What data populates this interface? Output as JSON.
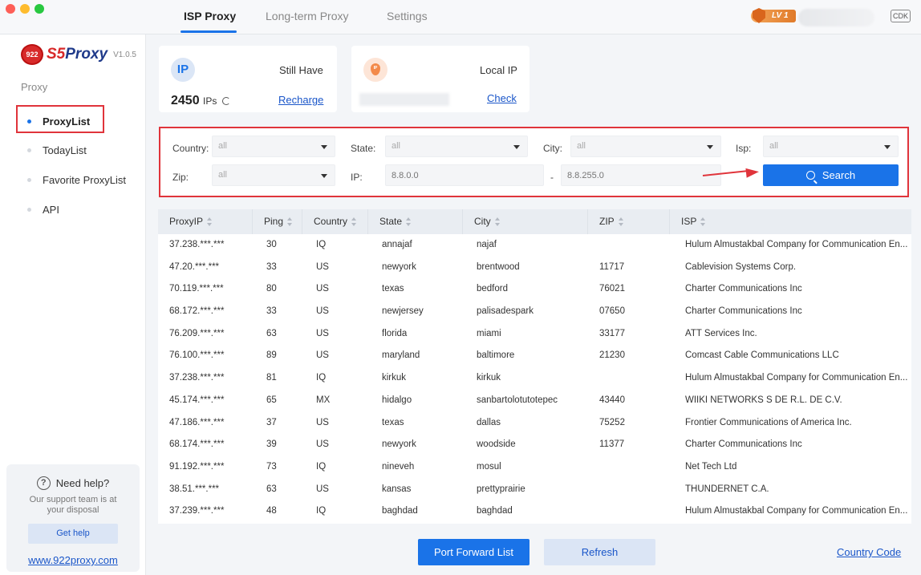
{
  "titlebar": {
    "tabs": [
      {
        "label": "ISP Proxy",
        "active": true
      },
      {
        "label": "Long-term Proxy",
        "active": false
      },
      {
        "label": "Settings",
        "active": false
      }
    ],
    "level_badge": "LV 1",
    "cdk_label": "CDK"
  },
  "sidebar": {
    "logo_num": "922",
    "logo_s5": "S5",
    "logo_proxy": "Proxy",
    "version": "V1.0.5",
    "section": "Proxy",
    "items": [
      {
        "label": "ProxyList",
        "active": true
      },
      {
        "label": "TodayList",
        "active": false
      },
      {
        "label": "Favorite ProxyList",
        "active": false
      },
      {
        "label": "API",
        "active": false
      }
    ],
    "help": {
      "title": "Need help?",
      "subtitle": "Our support team is at your disposal",
      "button": "Get help",
      "link": "www.922proxy.com"
    }
  },
  "ip_card": {
    "icon_text": "IP",
    "label": "Still Have",
    "count": "2450",
    "unit": "IPs",
    "link": "Recharge"
  },
  "local_card": {
    "icon_text": "IP",
    "label": "Local IP",
    "link": "Check"
  },
  "filters": {
    "country_label": "Country:",
    "country_value": "all",
    "state_label": "State:",
    "state_value": "all",
    "city_label": "City:",
    "city_value": "all",
    "isp_label": "Isp:",
    "isp_value": "all",
    "zip_label": "Zip:",
    "zip_value": "all",
    "ip_label": "IP:",
    "ip_from_placeholder": "8.8.0.0",
    "ip_dash": "-",
    "ip_to_placeholder": "8.8.255.0",
    "search_label": "Search"
  },
  "table": {
    "headers": [
      "ProxyIP",
      "Ping",
      "Country",
      "State",
      "City",
      "ZIP",
      "ISP"
    ],
    "rows": [
      [
        "37.238.***.***",
        "30",
        "IQ",
        "annajaf",
        "najaf",
        "",
        "Hulum Almustakbal Company for Communication En..."
      ],
      [
        "47.20.***.***",
        "33",
        "US",
        "newyork",
        "brentwood",
        "11717",
        "Cablevision Systems Corp."
      ],
      [
        "70.119.***.***",
        "80",
        "US",
        "texas",
        "bedford",
        "76021",
        "Charter Communications Inc"
      ],
      [
        "68.172.***.***",
        "33",
        "US",
        "newjersey",
        "palisadespark",
        "07650",
        "Charter Communications Inc"
      ],
      [
        "76.209.***.***",
        "63",
        "US",
        "florida",
        "miami",
        "33177",
        "ATT Services Inc."
      ],
      [
        "76.100.***.***",
        "89",
        "US",
        "maryland",
        "baltimore",
        "21230",
        "Comcast Cable Communications LLC"
      ],
      [
        "37.238.***.***",
        "81",
        "IQ",
        "kirkuk",
        "kirkuk",
        "",
        "Hulum Almustakbal Company for Communication En..."
      ],
      [
        "45.174.***.***",
        "65",
        "MX",
        "hidalgo",
        "sanbartolotutotepec",
        "43440",
        "WIIKI NETWORKS S DE R.L. DE C.V."
      ],
      [
        "47.186.***.***",
        "37",
        "US",
        "texas",
        "dallas",
        "75252",
        "Frontier Communications of America Inc."
      ],
      [
        "68.174.***.***",
        "39",
        "US",
        "newyork",
        "woodside",
        "11377",
        "Charter Communications Inc"
      ],
      [
        "91.192.***.***",
        "73",
        "IQ",
        "nineveh",
        "mosul",
        "",
        "Net Tech Ltd"
      ],
      [
        "38.51.***.***",
        "63",
        "US",
        "kansas",
        "prettyprairie",
        "",
        "THUNDERNET C.A."
      ],
      [
        "37.239.***.***",
        "48",
        "IQ",
        "baghdad",
        "baghdad",
        "",
        "Hulum Almustakbal Company for Communication En..."
      ]
    ]
  },
  "footer": {
    "port_forward": "Port Forward List",
    "refresh": "Refresh",
    "country_code": "Country Code"
  }
}
